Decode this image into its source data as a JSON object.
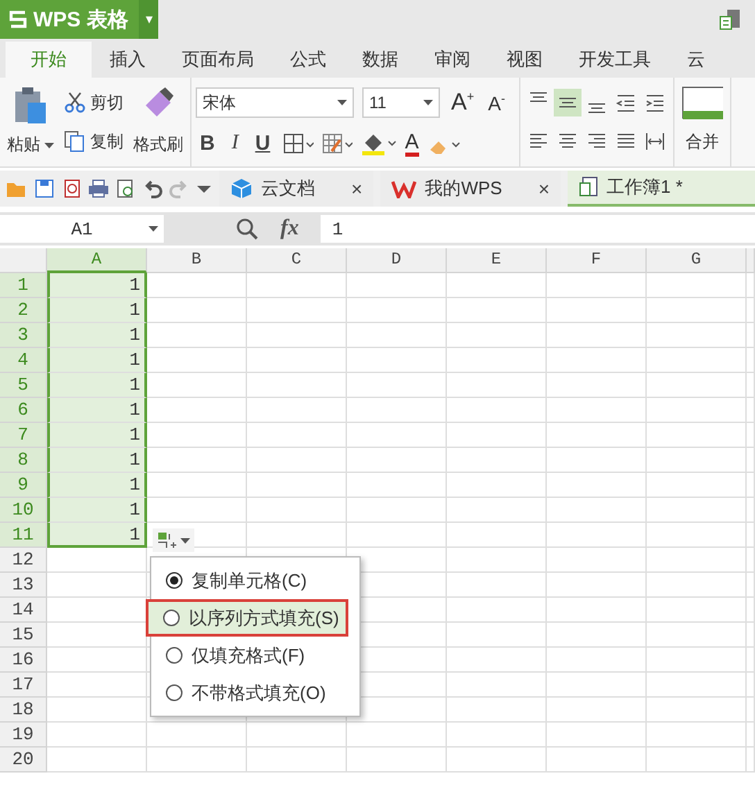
{
  "app": {
    "title": "WPS 表格",
    "dropdown": "▾"
  },
  "menu_tabs": [
    {
      "label": "开始",
      "selected": true
    },
    {
      "label": "插入",
      "selected": false
    },
    {
      "label": "页面布局",
      "selected": false
    },
    {
      "label": "公式",
      "selected": false
    },
    {
      "label": "数据",
      "selected": false
    },
    {
      "label": "审阅",
      "selected": false
    },
    {
      "label": "视图",
      "selected": false
    },
    {
      "label": "开发工具",
      "selected": false
    },
    {
      "label": "云",
      "selected": false
    }
  ],
  "ribbon": {
    "paste": "粘贴",
    "cut": "剪切",
    "copy": "复制",
    "format_painter": "格式刷",
    "font_name": "宋体",
    "font_size": "11",
    "grow": "A$^{+}$",
    "shrink": "A$^{-}$",
    "bold": "B",
    "italic": "I",
    "underline": "U",
    "font_color": "A",
    "merge": "合并",
    "align_buttons": [
      {
        "selected": false
      },
      {
        "selected": true
      },
      {
        "selected": false
      },
      {
        "selected": false
      },
      {
        "selected": false
      }
    ]
  },
  "doc_tabs": [
    {
      "kind": "cloud",
      "label": "云文档",
      "selected": false,
      "close": "×"
    },
    {
      "kind": "wps",
      "label": "我的WPS",
      "selected": false,
      "close": "×"
    },
    {
      "kind": "sheet",
      "label": "工作簿1 *",
      "selected": true
    }
  ],
  "formula_bar": {
    "name_box": "A1",
    "fx": "fx",
    "value": "1"
  },
  "sheet": {
    "columns": [
      {
        "label": "A",
        "selected": true
      },
      {
        "label": "B",
        "selected": false
      },
      {
        "label": "C",
        "selected": false
      },
      {
        "label": "D",
        "selected": false
      },
      {
        "label": "E",
        "selected": false
      },
      {
        "label": "F",
        "selected": false
      },
      {
        "label": "G",
        "selected": false
      }
    ],
    "rows": [
      {
        "label": "1",
        "cells": [
          "1"
        ],
        "selected": true
      },
      {
        "label": "2",
        "cells": [
          "1"
        ],
        "selected": true
      },
      {
        "label": "3",
        "cells": [
          "1"
        ],
        "selected": true
      },
      {
        "label": "4",
        "cells": [
          "1"
        ],
        "selected": true
      },
      {
        "label": "5",
        "cells": [
          "1"
        ],
        "selected": true
      },
      {
        "label": "6",
        "cells": [
          "1"
        ],
        "selected": true
      },
      {
        "label": "7",
        "cells": [
          "1"
        ],
        "selected": true
      },
      {
        "label": "8",
        "cells": [
          "1"
        ],
        "selected": true
      },
      {
        "label": "9",
        "cells": [
          "1"
        ],
        "selected": true
      },
      {
        "label": "10",
        "cells": [
          "1"
        ],
        "selected": true
      },
      {
        "label": "11",
        "cells": [
          "1"
        ],
        "selected": true
      },
      {
        "label": "12",
        "cells": [],
        "selected": false
      },
      {
        "label": "13",
        "cells": [],
        "selected": false
      },
      {
        "label": "14",
        "cells": [],
        "selected": false
      },
      {
        "label": "15",
        "cells": [],
        "selected": false
      },
      {
        "label": "16",
        "cells": [],
        "selected": false
      },
      {
        "label": "17",
        "cells": [],
        "selected": false
      },
      {
        "label": "18",
        "cells": [],
        "selected": false
      },
      {
        "label": "19",
        "cells": [],
        "selected": false
      },
      {
        "label": "20",
        "cells": [],
        "selected": false
      }
    ]
  },
  "fill_menu": {
    "items": [
      {
        "label": "复制单元格(C)",
        "selected": true,
        "highlighted": false
      },
      {
        "label": "以序列方式填充(S)",
        "selected": false,
        "highlighted": true
      },
      {
        "label": "仅填充格式(F)",
        "selected": false,
        "highlighted": false
      },
      {
        "label": "不带格式填充(O)",
        "selected": false,
        "highlighted": false
      }
    ]
  }
}
